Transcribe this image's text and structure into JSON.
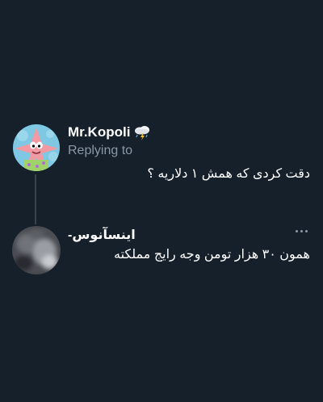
{
  "colors": {
    "background": "#15202b",
    "text_primary": "#ffffff",
    "text_secondary": "#8b98a5",
    "thread_line": "#38444d"
  },
  "parent_tweet": {
    "author_name": "Mr.Kopoli",
    "author_emoji_icon": "cloud-rain-lightning-icon",
    "replying_label": "Replying to",
    "text": "دقت کردی که همش ۱ دلاریه ؟"
  },
  "reply_tweet": {
    "author_name": "اینسآنوس-",
    "more_icon": "more-dots-icon",
    "text": "همون ۳۰ هزار تومن وجه رایج مملکته"
  }
}
